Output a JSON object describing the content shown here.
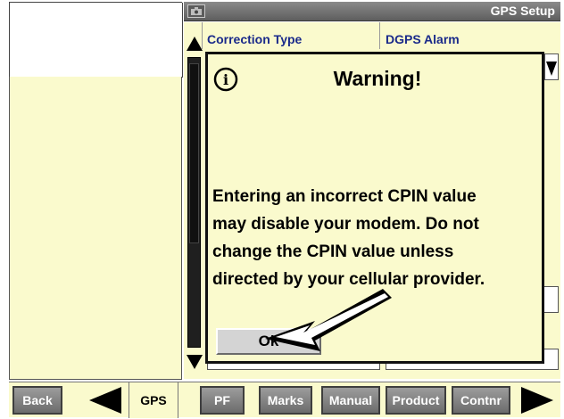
{
  "header": {
    "title": "GPS Setup",
    "icon": "camera-icon"
  },
  "columns": {
    "left": "Correction Type",
    "right": "DGPS Alarm"
  },
  "dialog": {
    "icon": "info-icon",
    "icon_glyph": "i",
    "title": "Warning!",
    "message": "Entering an incorrect CPIN value\nmay disable your modem. Do not\nchange the CPIN value unless\ndirected by your cellular provider.",
    "ok_label": "Ok"
  },
  "bottom_nav": {
    "back": "Back",
    "gps": "GPS",
    "pf": "PF",
    "marks": "Marks",
    "manual": "Manual",
    "product": "Product",
    "contnr": "Contnr"
  },
  "colors": {
    "panel_bg": "#fafacd",
    "header_bg": "#6e6e6e",
    "column_text": "#1a2a8a",
    "button_bg": "#808080"
  }
}
